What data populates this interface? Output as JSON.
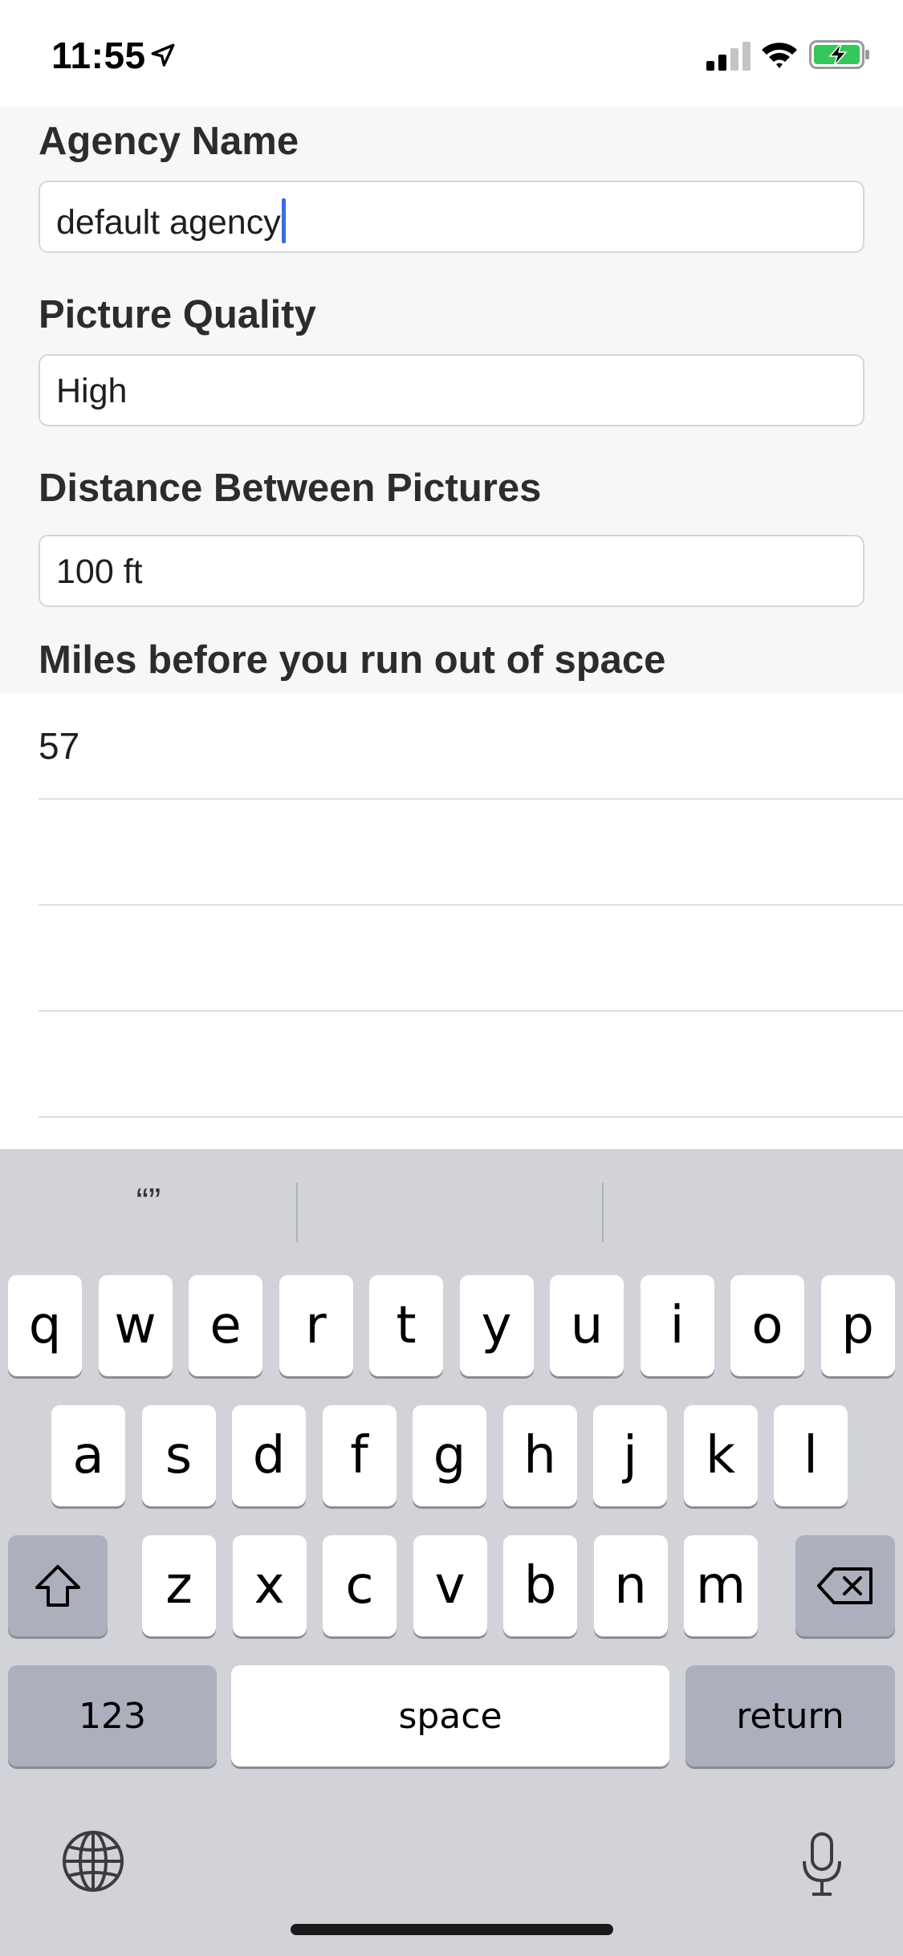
{
  "status_bar": {
    "time": "11:55"
  },
  "sections": [
    {
      "title": "Agency Name",
      "value": "default agency"
    },
    {
      "title": "Picture Quality",
      "value": "High"
    },
    {
      "title": "Distance Between Pictures",
      "value": "100 ft"
    },
    {
      "title": "Miles before you run out of space",
      "value": "57"
    }
  ],
  "keyboard": {
    "prediction_left": "“”",
    "row1": [
      "q",
      "w",
      "e",
      "r",
      "t",
      "y",
      "u",
      "i",
      "o",
      "p"
    ],
    "row2": [
      "a",
      "s",
      "d",
      "f",
      "g",
      "h",
      "j",
      "k",
      "l"
    ],
    "row3": [
      "z",
      "x",
      "c",
      "v",
      "b",
      "n",
      "m"
    ],
    "numbers_label": "123",
    "space_label": "space",
    "return_label": "return"
  },
  "colors": {
    "caret": "#3a6ee8",
    "battery_fill": "#35c759",
    "keyboard_bg": "#d1d3d9",
    "special_key": "#abb0bc"
  }
}
